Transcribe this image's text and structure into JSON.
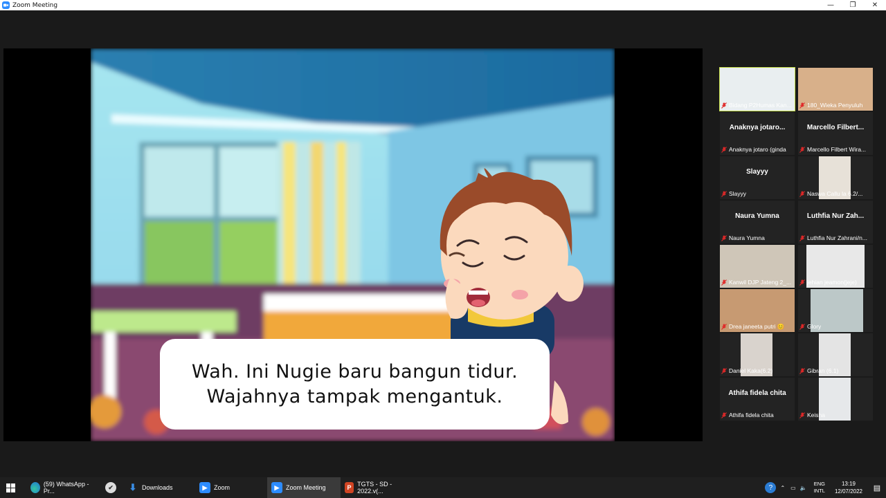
{
  "window": {
    "title": "Zoom Meeting",
    "minimize": "—",
    "maximize": "❐",
    "close": "✕"
  },
  "slide": {
    "caption_line1": "Wah. Ini Nugie baru bangun tidur.",
    "caption_line2": "Wajahnya tampak mengantuk."
  },
  "gallery": {
    "tiles": [
      {
        "big": "",
        "label": "Bidang P2Humas Kan..."
      },
      {
        "big": "",
        "label": "180_Wieka Penyuluh"
      },
      {
        "big": "Anaknya  jotaro...",
        "label": "Anaknya jotaro (ginda"
      },
      {
        "big": "Marcello  Filbert...",
        "label": "Marcello Filbert Wira..."
      },
      {
        "big": "Slayyy",
        "label": "Slayyy"
      },
      {
        "big": "",
        "label": "Naswa Callu la 6.2/..."
      },
      {
        "big": "Naura Yumna",
        "label": "Naura Yumna"
      },
      {
        "big": "Luthfia  Nur  Zah...",
        "label": "Luthfia Nur Zahrani/n..."
      },
      {
        "big": "",
        "label": "Kanwil DJP Jateng 2_..."
      },
      {
        "big": "",
        "label": "jehian jeamon(jeje)"
      },
      {
        "big": "",
        "label": "Drea janeeta putri 😊"
      },
      {
        "big": "",
        "label": "Glory"
      },
      {
        "big": "",
        "label": "Daniel Kaka(6.2)"
      },
      {
        "big": "",
        "label": "Gibran (6.1)"
      },
      {
        "big": "Athifa fidela chita",
        "label": "Athifa fidela chita"
      },
      {
        "big": "",
        "label": "Keisha"
      }
    ]
  },
  "taskbar": {
    "items": [
      {
        "label": "(59) WhatsApp - Pr...",
        "icon": "edge-icon"
      },
      {
        "label": "",
        "icon": "app-icon"
      },
      {
        "label": "Downloads",
        "icon": "download-icon"
      },
      {
        "label": "Zoom",
        "icon": "zoom-icon"
      },
      {
        "label": "Zoom Meeting",
        "icon": "zoom-icon"
      },
      {
        "label": "TGTS - SD - 2022.v(...",
        "icon": "powerpoint-icon"
      }
    ],
    "lang1": "ENG",
    "lang2": "INTL",
    "time": "13:19",
    "date": "12/07/2022"
  },
  "colors": {
    "accent": "#2d8cff",
    "active_border": "#c8e04a",
    "mic_off": "#e02828"
  }
}
